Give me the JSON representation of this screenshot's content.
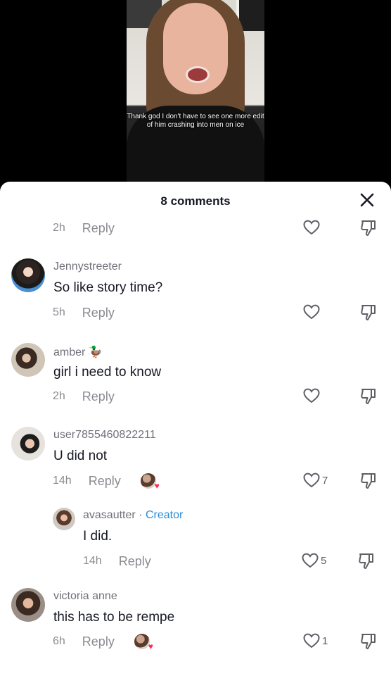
{
  "video": {
    "caption": "Thank god I don't have to see one more edit of him crashing into men on ice"
  },
  "sheet": {
    "title": "8 comments",
    "close_icon": "close-icon"
  },
  "reply_label": "Reply",
  "top_row": {
    "time": "2h",
    "likes": ""
  },
  "comments": [
    {
      "username": "Jennystreeter",
      "text": "So like story time?",
      "time": "5h",
      "likes": ""
    },
    {
      "username": "amber",
      "emoji": "🦆",
      "text": "girl i need to know",
      "time": "2h",
      "likes": ""
    },
    {
      "username": "user7855460822211",
      "text": "U did not",
      "time": "14h",
      "likes": "7",
      "liked_by_creator": true
    },
    {
      "username": "avasautter",
      "separator": "·",
      "creator_label": "Creator",
      "text": "I did.",
      "time": "14h",
      "likes": "5",
      "is_reply": true
    },
    {
      "username": "victoria anne",
      "text": "this has to be rempe",
      "time": "6h",
      "likes": "1",
      "liked_by_creator": true
    }
  ],
  "colors": {
    "accent_creator": "#2b8cd6",
    "heart": "#fe2c55"
  }
}
